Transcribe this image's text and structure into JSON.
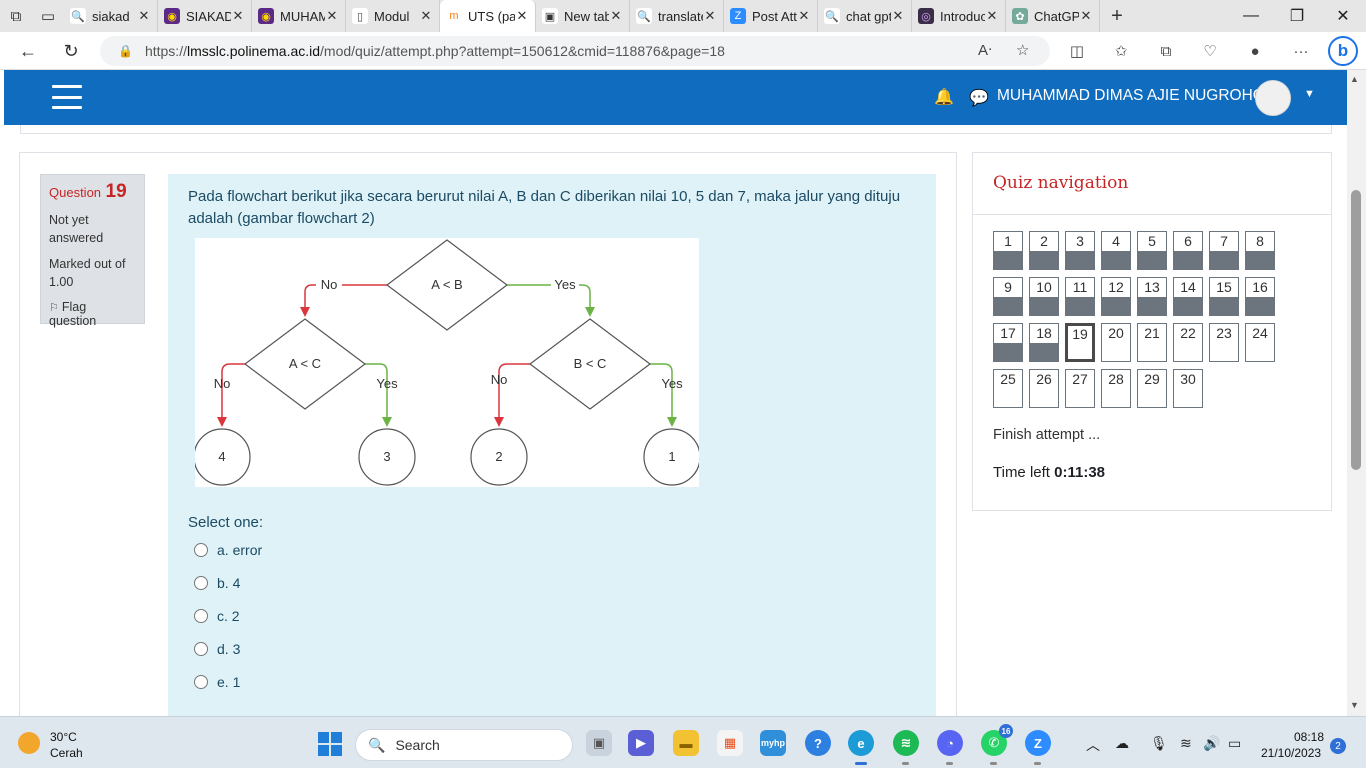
{
  "browser": {
    "tabs": [
      {
        "label": "siakad",
        "icon": "search-icon",
        "fav_bg": "#ffffff",
        "fav_fg": "#1a73e8",
        "glyph": "🔍"
      },
      {
        "label": "SIAKAD",
        "icon": "polinema-logo-icon",
        "fav_bg": "#5b2a86",
        "fav_fg": "#ffd700",
        "glyph": "◉"
      },
      {
        "label": "MUHAMMAD",
        "icon": "polinema-logo-icon",
        "fav_bg": "#5b2a86",
        "fav_fg": "#ffd700",
        "glyph": "◉"
      },
      {
        "label": "Modul",
        "icon": "document-icon",
        "fav_bg": "#ffffff",
        "fav_fg": "#444",
        "glyph": "▯"
      },
      {
        "label": "UTS (page",
        "icon": "moodle-icon",
        "fav_bg": "#ffffff",
        "fav_fg": "#f98012",
        "glyph": "m"
      },
      {
        "label": "New tab",
        "icon": "newtab-icon",
        "fav_bg": "#ffffff",
        "fav_fg": "#333",
        "glyph": "▣"
      },
      {
        "label": "translate",
        "icon": "search-icon",
        "fav_bg": "#ffffff",
        "fav_fg": "#1a73e8",
        "glyph": "🔍"
      },
      {
        "label": "Post Attend",
        "icon": "zoom-icon",
        "fav_bg": "#2d8cff",
        "fav_fg": "#ffffff",
        "glyph": "Z"
      },
      {
        "label": "chat gpt",
        "icon": "search-icon",
        "fav_bg": "#ffffff",
        "fav_fg": "#1a73e8",
        "glyph": "🔍"
      },
      {
        "label": "Introduction",
        "icon": "app-icon",
        "fav_bg": "#3a2d47",
        "fav_fg": "#d5a6ff",
        "glyph": "◎"
      },
      {
        "label": "ChatGPT",
        "icon": "chatgpt-icon",
        "fav_bg": "#74aa9c",
        "fav_fg": "#ffffff",
        "glyph": "✿"
      }
    ],
    "url_prefix": "https://",
    "url_host": "lmsslc.polinema.ac.id",
    "url_path": "/mod/quiz/attempt.php?attempt=150612&cmid=118876&page=18"
  },
  "navbar": {
    "user_name": "MUHAMMAD DIMAS AJIE NUGROHO",
    "bg_color": "#0f6cbf"
  },
  "question": {
    "label": "Question",
    "number": "19",
    "state": "Not yet answered",
    "grade": "Marked out of 1.00",
    "flag": "Flag question",
    "text": "Pada flowchart berikut jika secara berurut nilai A, B dan C diberikan nilai 10, 5 dan 7, maka jalur yang dituju adalah (gambar flowchart 2)",
    "select_label": "Select one:",
    "options": [
      {
        "letter": "a.",
        "text": "error"
      },
      {
        "letter": "b.",
        "text": "4"
      },
      {
        "letter": "c.",
        "text": "2"
      },
      {
        "letter": "d.",
        "text": "3"
      },
      {
        "letter": "e.",
        "text": "1"
      }
    ]
  },
  "flowchart": {
    "root": "A < B",
    "left_decision": "A < C",
    "right_decision": "B < C",
    "no": "No",
    "yes": "Yes",
    "outcomes": [
      "4",
      "3",
      "2",
      "1"
    ],
    "no_color": "#d9363e",
    "yes_color": "#6ab344"
  },
  "quiz_nav": {
    "title": "Quiz navigation",
    "buttons": [
      "1",
      "2",
      "3",
      "4",
      "5",
      "6",
      "7",
      "8",
      "9",
      "10",
      "11",
      "12",
      "13",
      "14",
      "15",
      "16",
      "17",
      "18",
      "19",
      "20",
      "21",
      "22",
      "23",
      "24",
      "25",
      "26",
      "27",
      "28",
      "29",
      "30"
    ],
    "answered": [
      "1",
      "2",
      "3",
      "4",
      "5",
      "6",
      "7",
      "8",
      "9",
      "10",
      "11",
      "12",
      "13",
      "14",
      "15",
      "16",
      "17",
      "18"
    ],
    "current": "19",
    "finish": "Finish attempt ...",
    "time_label": "Time left",
    "time_value": "0:11:38"
  },
  "taskbar": {
    "temperature": "30°C",
    "condition": "Cerah",
    "search": "Search",
    "time": "08:18",
    "date": "21/10/2023",
    "notifications": "2",
    "whatsapp_badge": "16"
  }
}
